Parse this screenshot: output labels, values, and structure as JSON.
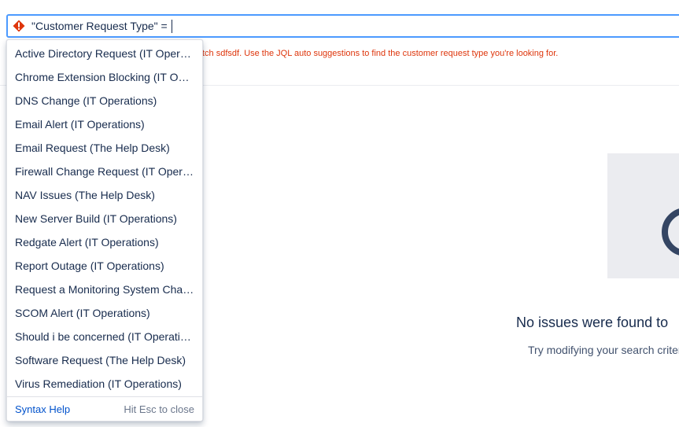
{
  "search": {
    "query": "\"Customer Request Type\" =",
    "error_icon": "error-icon",
    "error_message": "tch sdfsdf. Use the JQL auto suggestions to find the customer request type you're looking for.",
    "error_color": "#de350b",
    "focus_color": "#4c9aff"
  },
  "suggestions": {
    "items": [
      {
        "label": "Active Directory Request (IT Operations)"
      },
      {
        "label": "Chrome Extension Blocking (IT Operations)"
      },
      {
        "label": "DNS Change (IT Operations)"
      },
      {
        "label": "Email Alert (IT Operations)"
      },
      {
        "label": "Email Request (The Help Desk)"
      },
      {
        "label": "Firewall Change Request (IT Operations)"
      },
      {
        "label": "NAV Issues (The Help Desk)"
      },
      {
        "label": "New Server Build (IT Operations)"
      },
      {
        "label": "Redgate Alert (IT Operations)"
      },
      {
        "label": "Report Outage (IT Operations)"
      },
      {
        "label": "Request a Monitoring System Change (IT Operations)"
      },
      {
        "label": "SCOM Alert (IT Operations)"
      },
      {
        "label": "Should i be concerned (IT Operations)"
      },
      {
        "label": "Software Request (The Help Desk)"
      },
      {
        "label": "Virus Remediation (IT Operations)"
      }
    ],
    "footer": {
      "syntax_help": "Syntax Help",
      "esc_hint": "Hit Esc to close"
    }
  },
  "empty_state": {
    "title": "No issues were found to",
    "subtitle": "Try modifying your search criter"
  }
}
